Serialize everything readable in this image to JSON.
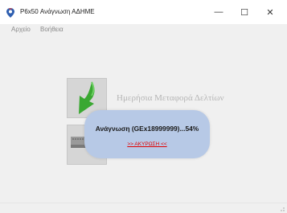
{
  "window": {
    "title": "P6x50 Ανάγνωση ΑΔΗΜΕ",
    "controls": {
      "minimize": "—",
      "maximize": "☐",
      "close": "✕"
    }
  },
  "menu": {
    "items": [
      "Αρχείο",
      "Βοήθεια"
    ]
  },
  "main": {
    "feature_label": "Ημερήσια Μεταφορά Δελτίων",
    "feature_label_2": "Α"
  },
  "progress": {
    "text": "Ανάγνωση (GEx18999999)...54%",
    "percent": 54,
    "cancel_label": ">> ΑΚΥΡΩΣΗ <<"
  },
  "icons": {
    "app": "app-logo-icon",
    "tile_1": "green-download-arrow-icon",
    "tile_2": "device-tape-icon"
  },
  "colors": {
    "popup_background": "#b7c9e6",
    "cancel_link": "#e00000",
    "arrow_green": "#3aa832"
  }
}
